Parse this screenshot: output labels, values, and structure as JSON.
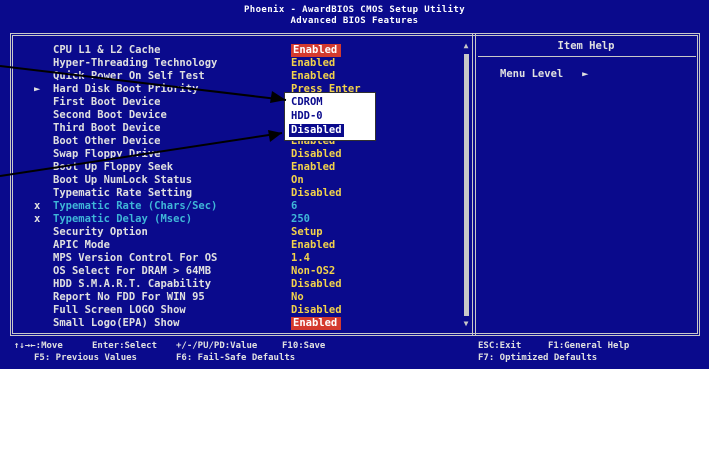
{
  "title": {
    "line1": "Phoenix - AwardBIOS CMOS Setup Utility",
    "line2": "Advanced BIOS Features"
  },
  "settings": [
    {
      "label": "CPU L1 & L2 Cache",
      "value": "Enabled",
      "highlight": true
    },
    {
      "label": "Hyper-Threading Technology",
      "value": "Enabled"
    },
    {
      "label": "Quick Power On Self Test",
      "value": "Enabled"
    },
    {
      "label": "Hard Disk Boot Priority",
      "value": "Press Enter",
      "marker": "►"
    },
    {
      "label": "First Boot Device",
      "value": "CDROM"
    },
    {
      "label": "Second Boot Device",
      "value": "HDD-0"
    },
    {
      "label": "Third Boot Device",
      "value": "Disabled"
    },
    {
      "label": "Boot Other Device",
      "value": "Enabled"
    },
    {
      "label": "Swap Floppy Drive",
      "value": "Disabled"
    },
    {
      "label": "Boot Up Floppy Seek",
      "value": "Enabled"
    },
    {
      "label": "Boot Up NumLock Status",
      "value": "On"
    },
    {
      "label": "Typematic Rate Setting",
      "value": "Disabled"
    },
    {
      "label": "Typematic Rate (Chars/Sec)",
      "value": "6",
      "disabled": true,
      "marker": "x"
    },
    {
      "label": "Typematic Delay (Msec)",
      "value": "250",
      "disabled": true,
      "marker": "x"
    },
    {
      "label": "Security Option",
      "value": "Setup"
    },
    {
      "label": "APIC Mode",
      "value": "Enabled"
    },
    {
      "label": "MPS Version Control For OS",
      "value": "1.4"
    },
    {
      "label": "OS Select For DRAM > 64MB",
      "value": "Non-OS2"
    },
    {
      "label": "HDD S.M.A.R.T. Capability",
      "value": "Disabled"
    },
    {
      "label": "Report No FDD For WIN 95",
      "value": "No"
    },
    {
      "label": "Full Screen LOGO Show",
      "value": "Disabled"
    },
    {
      "label": "Small Logo(EPA) Show",
      "value": "Enabled",
      "highlight": true
    }
  ],
  "popup": {
    "options": [
      "CDROM",
      "HDD-0",
      "Disabled"
    ],
    "selected_index": 2
  },
  "help": {
    "title": "Item Help",
    "text": "Menu Level   ►"
  },
  "scrollbar": {
    "up": "▲",
    "down": "▼"
  },
  "keys": {
    "move": "↑↓→←:Move",
    "enter": "Enter:Select",
    "value": "+/-/PU/PD:Value",
    "save": "F10:Save",
    "esc": "ESC:Exit",
    "help": "F1:General Help",
    "prev": "F5: Previous Values",
    "failsafe": "F6: Fail-Safe Defaults",
    "optimized": "F7: Optimized Defaults"
  },
  "colors": {
    "background": "#0a0a8c",
    "value": "#f2d24a",
    "highlight": "#d43a2e",
    "disabled": "#3fb6d8"
  }
}
